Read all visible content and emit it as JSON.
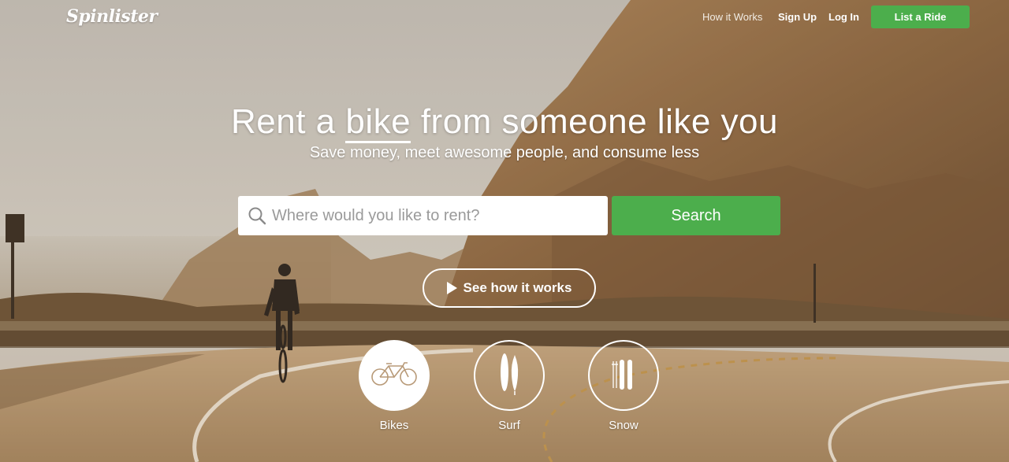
{
  "brand": {
    "logo_text": "Spinlister"
  },
  "nav": {
    "how_it_works": "How it Works",
    "sign_up": "Sign Up",
    "log_in": "Log In",
    "list_a_ride": "List a Ride"
  },
  "hero": {
    "headline_before": "Rent a ",
    "headline_highlight": "bike",
    "headline_after": " from someone like you",
    "subheadline": "Save money, meet awesome people, and consume less"
  },
  "search": {
    "placeholder": "Where would you like to rent?",
    "value": "",
    "button_label": "Search"
  },
  "video_button": {
    "label": "See how it works"
  },
  "categories": [
    {
      "label": "Bikes",
      "icon": "bike-icon",
      "active": true
    },
    {
      "label": "Surf",
      "icon": "surfboard-icon",
      "active": false
    },
    {
      "label": "Snow",
      "icon": "ski-icon",
      "active": false
    }
  ],
  "colors": {
    "accent": "#4cae4c",
    "text": "#ffffff"
  }
}
